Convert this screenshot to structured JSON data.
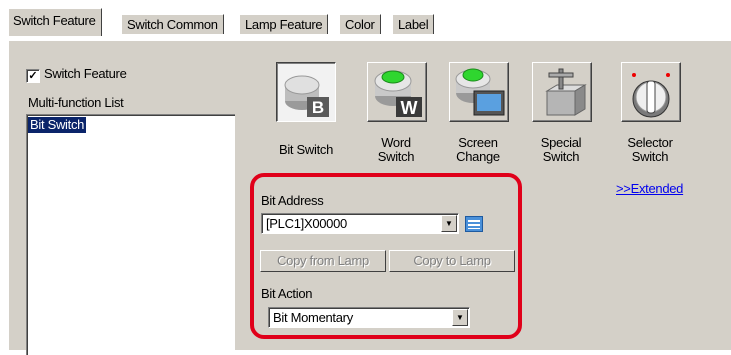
{
  "tabs": [
    {
      "label": "Switch Feature",
      "active": true
    },
    {
      "label": "Switch Common",
      "active": false
    },
    {
      "label": "Lamp Feature",
      "active": false
    },
    {
      "label": "Color",
      "active": false
    },
    {
      "label": "Label",
      "active": false
    }
  ],
  "left": {
    "checkbox_label": "Switch Feature",
    "checkbox_checked": true,
    "list_label": "Multi-function List",
    "list_items": [
      "Bit Switch"
    ]
  },
  "features": [
    {
      "line1": "Bit Switch",
      "line2": "",
      "icon": "bit-switch-icon",
      "selected": true
    },
    {
      "line1": "Word",
      "line2": "Switch",
      "icon": "word-switch-icon",
      "selected": false
    },
    {
      "line1": "Screen",
      "line2": "Change",
      "icon": "screen-change-icon",
      "selected": false
    },
    {
      "line1": "Special",
      "line2": "Switch",
      "icon": "special-switch-icon",
      "selected": false
    },
    {
      "line1": "Selector",
      "line2": "Switch",
      "icon": "selector-switch-icon",
      "selected": false
    }
  ],
  "extended_link": ">>Extended",
  "bit_address": {
    "label": "Bit Address",
    "value": "[PLC1]X00000",
    "icon": "address-input-icon"
  },
  "buttons": {
    "copy_from": "Copy from Lamp",
    "copy_to": "Copy to Lamp"
  },
  "bit_action": {
    "label": "Bit Action",
    "value": "Bit Momentary"
  },
  "colors": {
    "highlight": "#e0001a",
    "selection": "#0a246a",
    "panel": "#d4d0c8",
    "link": "#0000ee"
  }
}
